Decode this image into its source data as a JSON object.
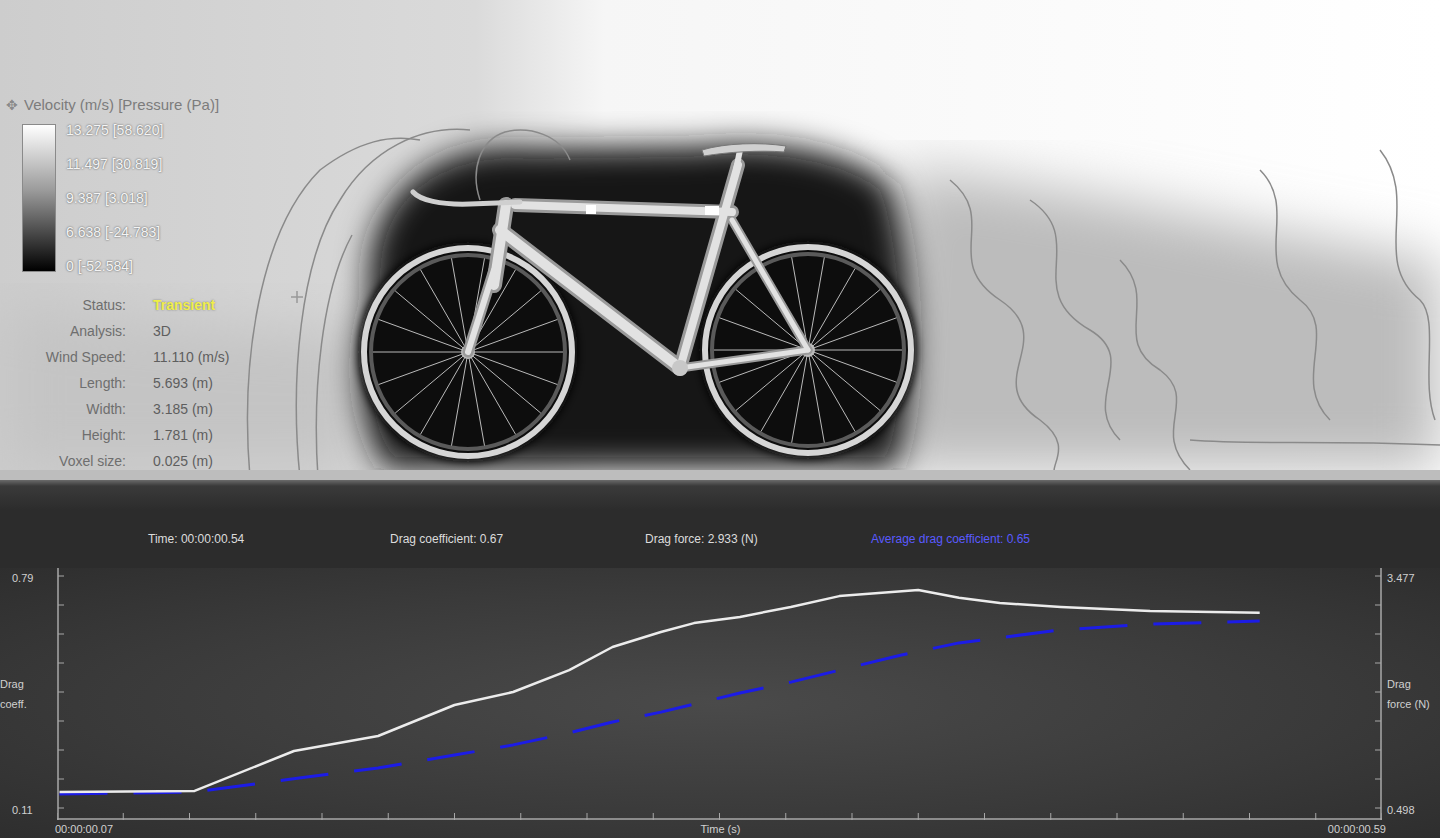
{
  "legend": {
    "icon": "✥",
    "title": "Velocity (m/s) [Pressure (Pa)]",
    "stops": [
      "13.275 [58.620]",
      "11.497 [30.819]",
      "9.387 [3.018]",
      "6.638 [-24.783]",
      "0 [-52.584]"
    ]
  },
  "info": [
    {
      "label": "Status:",
      "value": "Transient",
      "highlight": true
    },
    {
      "label": "Analysis:",
      "value": "3D",
      "highlight": false
    },
    {
      "label": "Wind Speed:",
      "value": "11.110 (m/s)",
      "highlight": false
    },
    {
      "label": "Length:",
      "value": "5.693 (m)",
      "highlight": false
    },
    {
      "label": "Width:",
      "value": "3.185 (m)",
      "highlight": false
    },
    {
      "label": "Height:",
      "value": "1.781 (m)",
      "highlight": false
    },
    {
      "label": "Voxel size:",
      "value": "0.025 (m)",
      "highlight": false
    }
  ],
  "stats": [
    {
      "text": "Time: 00:00:00.54",
      "color": "#dcdcdc"
    },
    {
      "text": "Drag coefficient: 0.67",
      "color": "#dcdcdc"
    },
    {
      "text": "Drag force: 2.933 (N)",
      "color": "#dcdcdc"
    },
    {
      "text": "Average drag coefficient: 0.65",
      "color": "#5a5aff"
    }
  ],
  "chart": {
    "y_left": {
      "title": "Drag coeff.",
      "max": "0.79",
      "min": "0.11"
    },
    "y_right": {
      "title": "Drag force (N)",
      "max": "3.477",
      "min": "0.498"
    },
    "x_axis": {
      "title": "Time (s)",
      "start": "00:00:00.07",
      "end": "00:00:00.59"
    },
    "series": [
      {
        "kind": "dashed",
        "color": "#1c1ce6",
        "times": [
          0.071,
          0.124,
          0.165,
          0.196,
          0.226,
          0.249,
          0.271,
          0.288,
          0.307,
          0.338,
          0.358,
          0.377,
          0.401,
          0.424,
          0.464,
          0.499,
          0.542
        ],
        "values": [
          0.151,
          0.157,
          0.198,
          0.227,
          0.265,
          0.295,
          0.33,
          0.362,
          0.391,
          0.447,
          0.479,
          0.514,
          0.558,
          0.594,
          0.632,
          0.649,
          0.658
        ]
      },
      {
        "kind": "solid",
        "color": "#ececec",
        "times": [
          0.071,
          0.124,
          0.163,
          0.196,
          0.226,
          0.249,
          0.271,
          0.288,
          0.307,
          0.32,
          0.338,
          0.358,
          0.377,
          0.408,
          0.424,
          0.44,
          0.464,
          0.499,
          0.542
        ],
        "values": [
          0.157,
          0.16,
          0.277,
          0.321,
          0.412,
          0.45,
          0.514,
          0.582,
          0.626,
          0.652,
          0.67,
          0.699,
          0.731,
          0.749,
          0.726,
          0.711,
          0.699,
          0.687,
          0.682
        ]
      }
    ]
  }
}
